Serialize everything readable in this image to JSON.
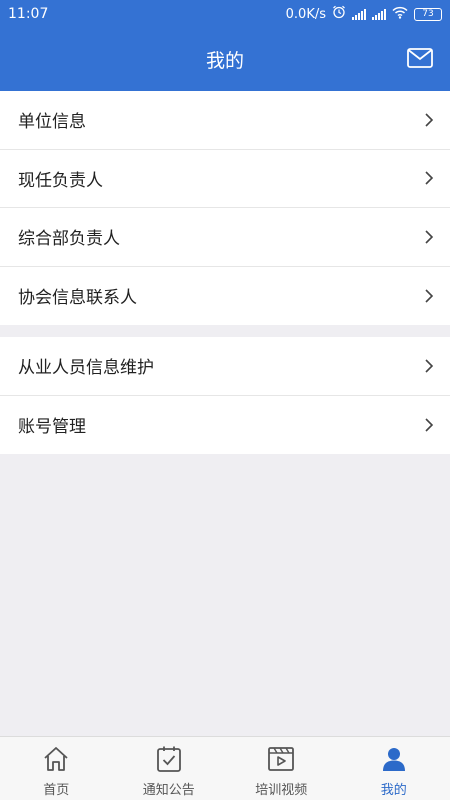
{
  "status_bar": {
    "time": "11:07",
    "network_speed": "0.0K/s",
    "battery": "73"
  },
  "header": {
    "title": "我的",
    "mail_icon": "mail-icon"
  },
  "menu_group_1": {
    "items": [
      {
        "label": "单位信息"
      },
      {
        "label": "现任负责人"
      },
      {
        "label": "综合部负责人"
      },
      {
        "label": "协会信息联系人"
      }
    ]
  },
  "menu_group_2": {
    "items": [
      {
        "label": "从业人员信息维护"
      },
      {
        "label": "账号管理"
      }
    ]
  },
  "tab_bar": {
    "tabs": [
      {
        "label": "首页",
        "icon": "home-icon"
      },
      {
        "label": "通知公告",
        "icon": "notice-icon"
      },
      {
        "label": "培训视频",
        "icon": "video-icon"
      },
      {
        "label": "我的",
        "icon": "person-icon",
        "active": true
      }
    ]
  },
  "colors": {
    "primary": "#3472d3",
    "active_tab": "#2c6ac9",
    "background": "#efeef2"
  }
}
